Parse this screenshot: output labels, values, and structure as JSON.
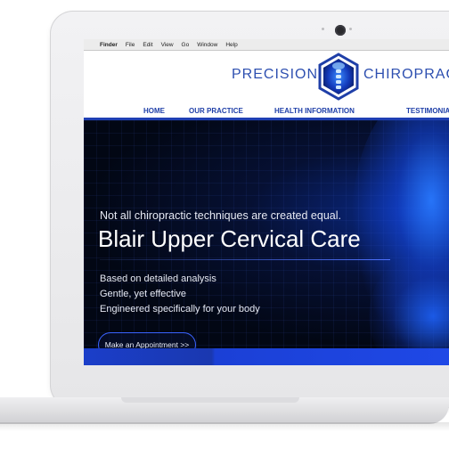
{
  "menubar": {
    "apple": "",
    "items": [
      "Finder",
      "File",
      "Edit",
      "View",
      "Go",
      "Window",
      "Help"
    ]
  },
  "logo": {
    "left": "PRECISION",
    "right": "CHIROPRACTIC"
  },
  "nav": {
    "items": [
      "HOME",
      "OUR PRACTICE",
      "HEALTH INFORMATION",
      "TESTIMONIALS"
    ]
  },
  "hero": {
    "tagline": "Not all chiropractic techniques are created equal.",
    "title": "Blair Upper Cervical Care",
    "points": [
      "Based on detailed analysis",
      "Gentle, yet effective",
      "Engineered specifically for your body"
    ],
    "cta": "Make an Appointment >>"
  },
  "colors": {
    "brand": "#2d4fb0",
    "nav": "#1f3fa8",
    "accent": "#3a63ff",
    "hero_bg": "#020714"
  }
}
